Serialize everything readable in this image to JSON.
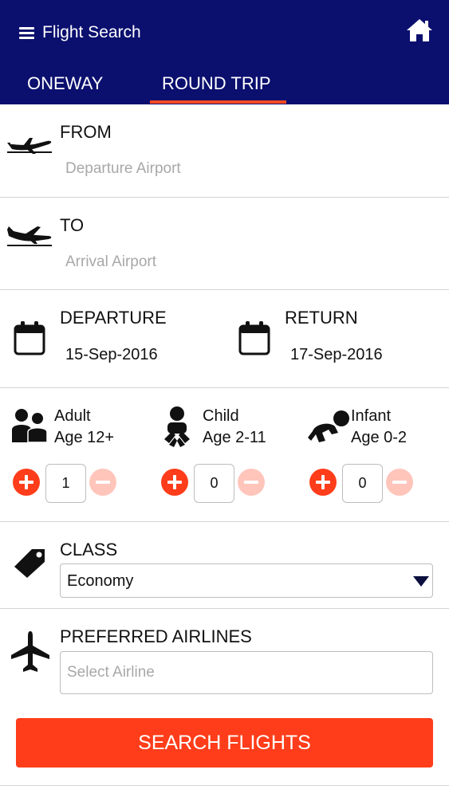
{
  "header": {
    "title": "Flight Search",
    "menu_icon": "hamburger-menu-icon",
    "home_icon": "home-icon",
    "bg_color": "#0b0f6e"
  },
  "tabs": [
    {
      "label": "ONEWAY",
      "active": false
    },
    {
      "label": "ROUND TRIP",
      "active": true
    }
  ],
  "from": {
    "label": "FROM",
    "placeholder": "Departure Airport",
    "icon": "plane-takeoff-icon"
  },
  "to": {
    "label": "TO",
    "placeholder": "Arrival Airport",
    "icon": "plane-landing-icon"
  },
  "dates": {
    "departure": {
      "label": "DEPARTURE",
      "value": "15-Sep-2016",
      "icon": "calendar-icon"
    },
    "return": {
      "label": "RETURN",
      "value": "17-Sep-2016",
      "icon": "calendar-icon"
    }
  },
  "passengers": [
    {
      "type": "Adult",
      "age": "Age 12+",
      "count": "1",
      "icon": "adult-icon"
    },
    {
      "type": "Child",
      "age": "Age 2-11",
      "count": "0",
      "icon": "child-icon"
    },
    {
      "type": "Infant",
      "age": "Age 0-2",
      "count": "0",
      "icon": "infant-icon"
    }
  ],
  "class": {
    "label": "CLASS",
    "selected": "Economy",
    "icon": "tag-icon"
  },
  "airlines": {
    "label": "PREFERRED AIRLINES",
    "placeholder": "Select Airline",
    "icon": "airplane-icon"
  },
  "search_button": {
    "label": "SEARCH FLIGHTS"
  },
  "colors": {
    "accent": "#ff3d1a",
    "accent_light": "#ffc5bb",
    "header": "#0b0f6e"
  }
}
